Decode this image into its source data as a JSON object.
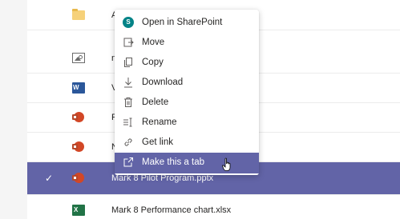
{
  "files": [
    {
      "name": "A",
      "type": "folder"
    },
    {
      "name": "n",
      "type": "image"
    },
    {
      "name": "V",
      "type": "word"
    },
    {
      "name": "F",
      "type": "powerpoint"
    },
    {
      "name": "N",
      "type": "powerpoint"
    },
    {
      "name": "Mark 8 Pilot Program.pptx",
      "type": "powerpoint",
      "selected": true
    },
    {
      "name": "Mark 8 Performance chart.xlsx",
      "type": "excel"
    }
  ],
  "context_menu": {
    "items": [
      {
        "label": "Open in SharePoint",
        "icon": "sharepoint-icon"
      },
      {
        "label": "Move",
        "icon": "move-icon"
      },
      {
        "label": "Copy",
        "icon": "copy-icon"
      },
      {
        "label": "Download",
        "icon": "download-icon"
      },
      {
        "label": "Delete",
        "icon": "trash-icon"
      },
      {
        "label": "Rename",
        "icon": "rename-icon"
      },
      {
        "label": "Get link",
        "icon": "link-icon"
      },
      {
        "label": "Make this a tab",
        "icon": "tab-icon",
        "active": true
      }
    ]
  },
  "colors": {
    "accent": "#6264a7",
    "sharepoint": "#038387",
    "word": "#2b579a",
    "powerpoint": "#d24726",
    "excel": "#217346",
    "folder": "#f6d17a"
  }
}
